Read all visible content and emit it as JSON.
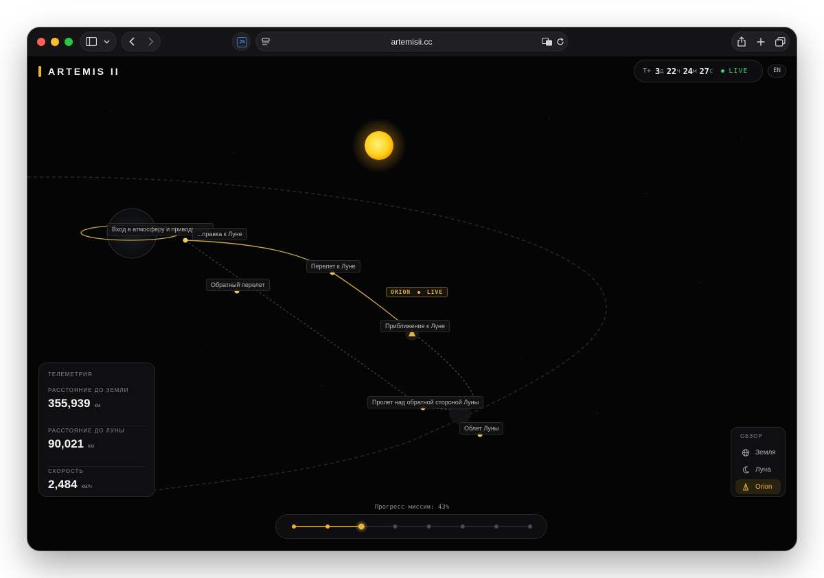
{
  "browser": {
    "url": "artemisii.cc",
    "js_badge": "JS",
    "traffic_lights": [
      "#ff5f57",
      "#febc2e",
      "#28c840"
    ]
  },
  "app": {
    "title": "ARTEMIS II",
    "accent": "#e8b440",
    "timer": {
      "prefix": "T+",
      "days": "3",
      "days_unit": "д",
      "hours": "22",
      "hours_unit": "ч",
      "minutes": "24",
      "minutes_unit": "м",
      "seconds": "27",
      "seconds_unit": "с",
      "live": "LIVE"
    },
    "lang": "EN"
  },
  "map": {
    "labels": {
      "reentry": "Вход в атмосферу и приводнение",
      "tli": "...правка к Луне",
      "transit_out": "Перелет к Луне",
      "return": "Обратный перелет",
      "approach": "Приближение к Луне",
      "farside": "Пролет над обратной стороной Луны",
      "flyby": "Облет Луны"
    },
    "orion_tag": "ORION",
    "orion_live": "LIVE"
  },
  "telemetry": {
    "title": "ТЕЛЕМЕТРИЯ",
    "rows": [
      {
        "label": "РАССТОЯНИЕ ДО ЗЕМЛИ",
        "value": "355,939",
        "unit": "км"
      },
      {
        "label": "РАССТОЯНИЕ ДО ЛУНЫ",
        "value": "90,021",
        "unit": "км"
      },
      {
        "label": "СКОРОСТЬ",
        "value": "2,484",
        "unit": "км/ч"
      }
    ]
  },
  "overview": {
    "title": "ОБЗОР",
    "items": [
      {
        "label": "Земля",
        "icon": "globe-icon",
        "active": false
      },
      {
        "label": "Луна",
        "icon": "moon-icon",
        "active": false
      },
      {
        "label": "Orion",
        "icon": "spacecraft-icon",
        "active": true
      }
    ]
  },
  "progress": {
    "label": "Прогресс миссии: 43%",
    "percent": 43,
    "milestones": 8,
    "current_index": 2
  }
}
